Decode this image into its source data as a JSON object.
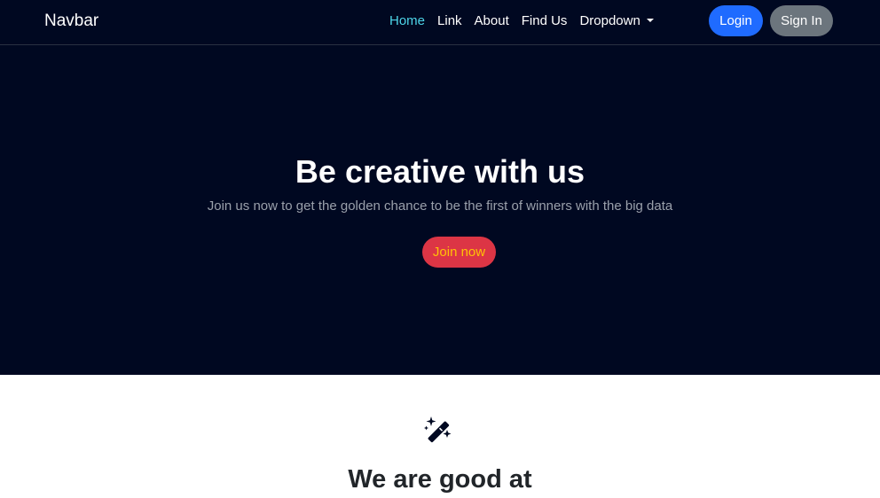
{
  "navbar": {
    "brand": "Navbar",
    "links": [
      {
        "label": "Home",
        "active": true
      },
      {
        "label": "Link",
        "active": false
      },
      {
        "label": "About",
        "active": false
      },
      {
        "label": "Find Us",
        "active": false
      },
      {
        "label": "Dropdown",
        "active": false
      }
    ],
    "login_label": "Login",
    "signin_label": "Sign In"
  },
  "hero": {
    "title": "Be creative with us",
    "subtitle": "Join us now to get the golden chance to be the first of winners with the big data",
    "join_label": "Join now"
  },
  "section": {
    "icon": "magic-wand-icon",
    "title": "We are good at"
  },
  "colors": {
    "background_dark": "#000821",
    "active_link": "#4dd4e8",
    "login_button": "#1f6bff",
    "signin_button": "#6c757d",
    "join_button": "#dc3545",
    "join_text": "#ffc107"
  }
}
